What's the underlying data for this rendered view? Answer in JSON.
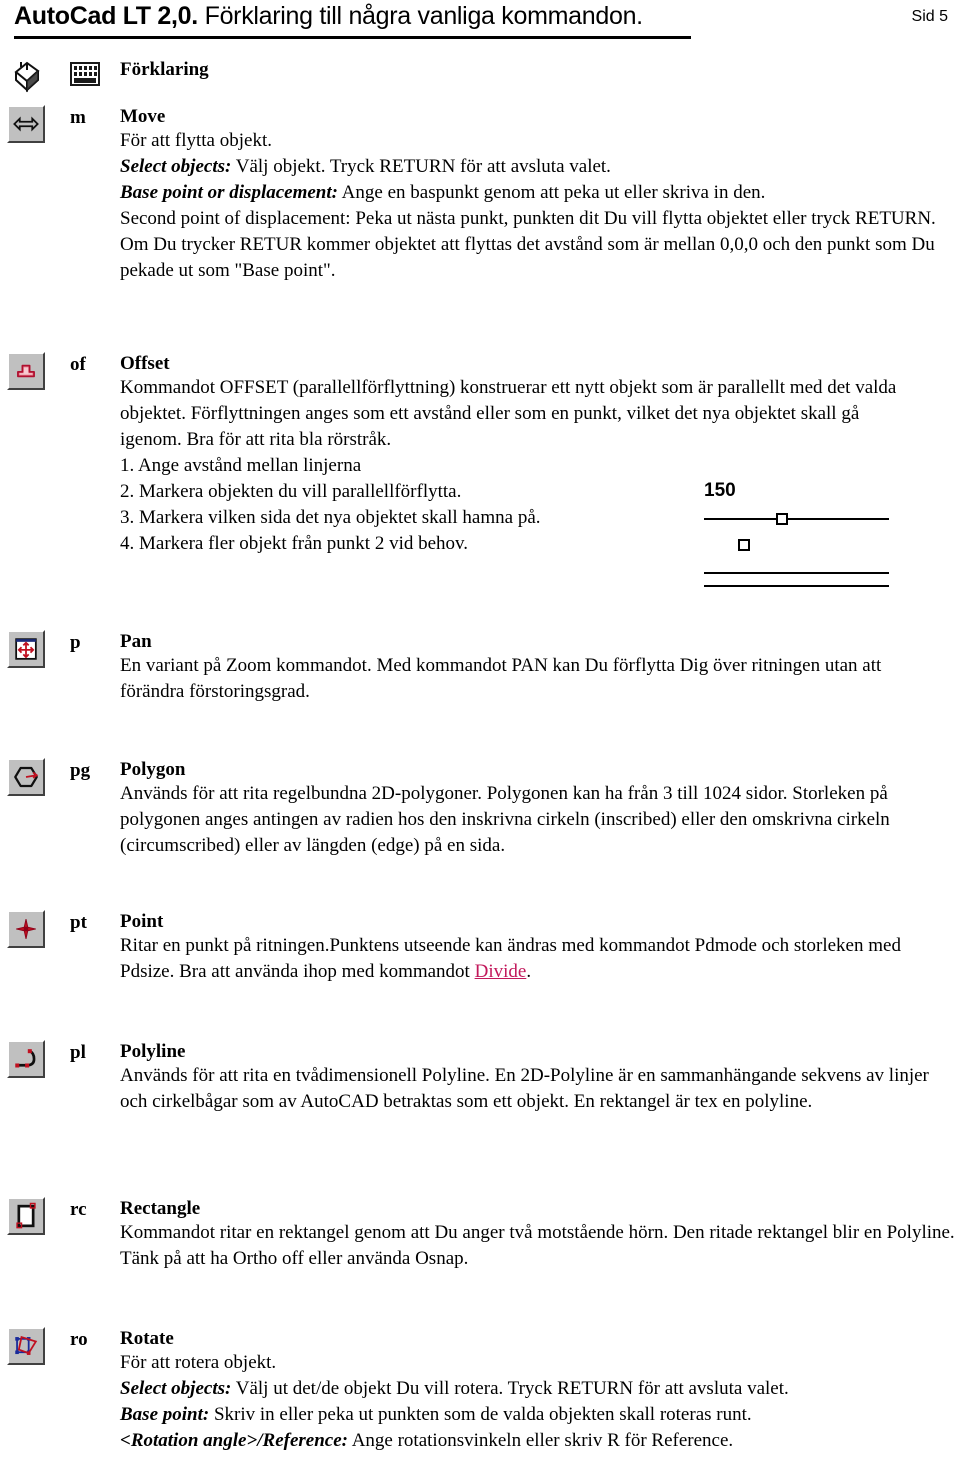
{
  "header": {
    "app_title": "AutoCad LT 2,0.",
    "subtitle": "Förklaring till några vanliga kommandon.",
    "page_label": "Sid 5"
  },
  "legend": {
    "mouse_icon": "mouse-icon",
    "keyboard_icon": "keyboard-icon",
    "label": "Förklaring"
  },
  "link_color": "#c2185b",
  "entries": [
    {
      "icon": "move-arrows-icon",
      "abbr": "m",
      "title": "Move",
      "lines": [
        {
          "text": "För att flytta objekt."
        },
        {
          "lead": "Select objects:",
          "text": " Välj objekt. Tryck RETURN för att avsluta valet."
        },
        {
          "lead": "Base point or displacement:",
          "text": " Ange en baspunkt genom att peka ut eller skriva in den."
        },
        {
          "text": "Second point of displacement: Peka ut nästa punkt, punkten dit Du vill flytta objektet eller tryck RETURN. Om Du trycker RETUR kommer objektet att flyttas det avstånd som är mellan 0,0,0 och den punkt som Du pekade ut som \"Base point\"."
        }
      ]
    },
    {
      "icon": "offset-icon",
      "abbr": "of",
      "title": "Offset",
      "lines": [
        {
          "text": "Kommandot OFFSET (parallellförflyttning) konstruerar ett nytt objekt som är parallellt med det valda objektet. Förflyttningen anges som ett avstånd eller som en punkt, vilket det nya objektet skall gå igenom. Bra för att rita bla rörstråk."
        },
        {
          "text": "1. Ange avstånd mellan linjerna"
        },
        {
          "text": "2. Markera objekten du vill parallellförflytta."
        },
        {
          "text": "3. Markera vilken sida det nya objektet skall hamna på."
        },
        {
          "text": "4. Markera fler objekt från punkt 2 vid behov."
        }
      ],
      "figure": {
        "name": "offset-diagram",
        "dimension_label": "150"
      }
    },
    {
      "icon": "pan-icon",
      "abbr": "p",
      "title": "Pan",
      "lines": [
        {
          "text": "En variant på Zoom kommandot. Med kommandot PAN kan Du förflytta Dig över ritningen utan att förändra förstoringsgrad."
        }
      ]
    },
    {
      "icon": "polygon-icon",
      "abbr": "pg",
      "title": "Polygon",
      "lines": [
        {
          "text": "Används för att rita regelbundna 2D-polygoner. Polygonen kan ha från 3 till 1024 sidor. Storleken på polygonen anges antingen av radien hos den inskrivna cirkeln (inscribed) eller den omskrivna cirkeln (circumscribed) eller av längden (edge) på en sida."
        }
      ]
    },
    {
      "icon": "point-icon",
      "abbr": "pt",
      "title": "Point",
      "lines": [
        {
          "text": "Ritar en punkt på ritningen.Punktens utseende kan ändras med kommandot Pdmode och storleken med Pdsize. Bra att använda ihop med kommandot ",
          "link": "Divide",
          "tail": "."
        }
      ]
    },
    {
      "icon": "polyline-icon",
      "abbr": "pl",
      "title": "Polyline",
      "lines": [
        {
          "text": "Används för att rita en tvådimensionell Polyline. En 2D-Polyline är en sammanhängande sekvens av linjer och cirkelbågar som av AutoCAD betraktas som ett objekt. En rektangel är tex en polyline."
        }
      ]
    },
    {
      "icon": "rectangle-icon",
      "abbr": "rc",
      "title": "Rectangle",
      "lines": [
        {
          "text": "Kommandot ritar en rektangel genom att Du anger två motstående hörn. Den ritade rektangel blir en Polyline. Tänk på att ha Ortho off eller använda Osnap."
        }
      ]
    },
    {
      "icon": "rotate-icon",
      "abbr": "ro",
      "title": "Rotate",
      "lines": [
        {
          "text": "För att rotera objekt."
        },
        {
          "lead": "Select objects:",
          "text": " Välj ut det/de objekt Du vill rotera. Tryck RETURN för att avsluta valet."
        },
        {
          "lead": "Base point:",
          "text": " Skriv in eller peka ut punkten som de valda objekten skall roteras runt."
        },
        {
          "lead": "<Rotation angle>/Reference:",
          "text": " Ange rotationsvinkeln eller skriv R för Reference."
        }
      ]
    }
  ]
}
